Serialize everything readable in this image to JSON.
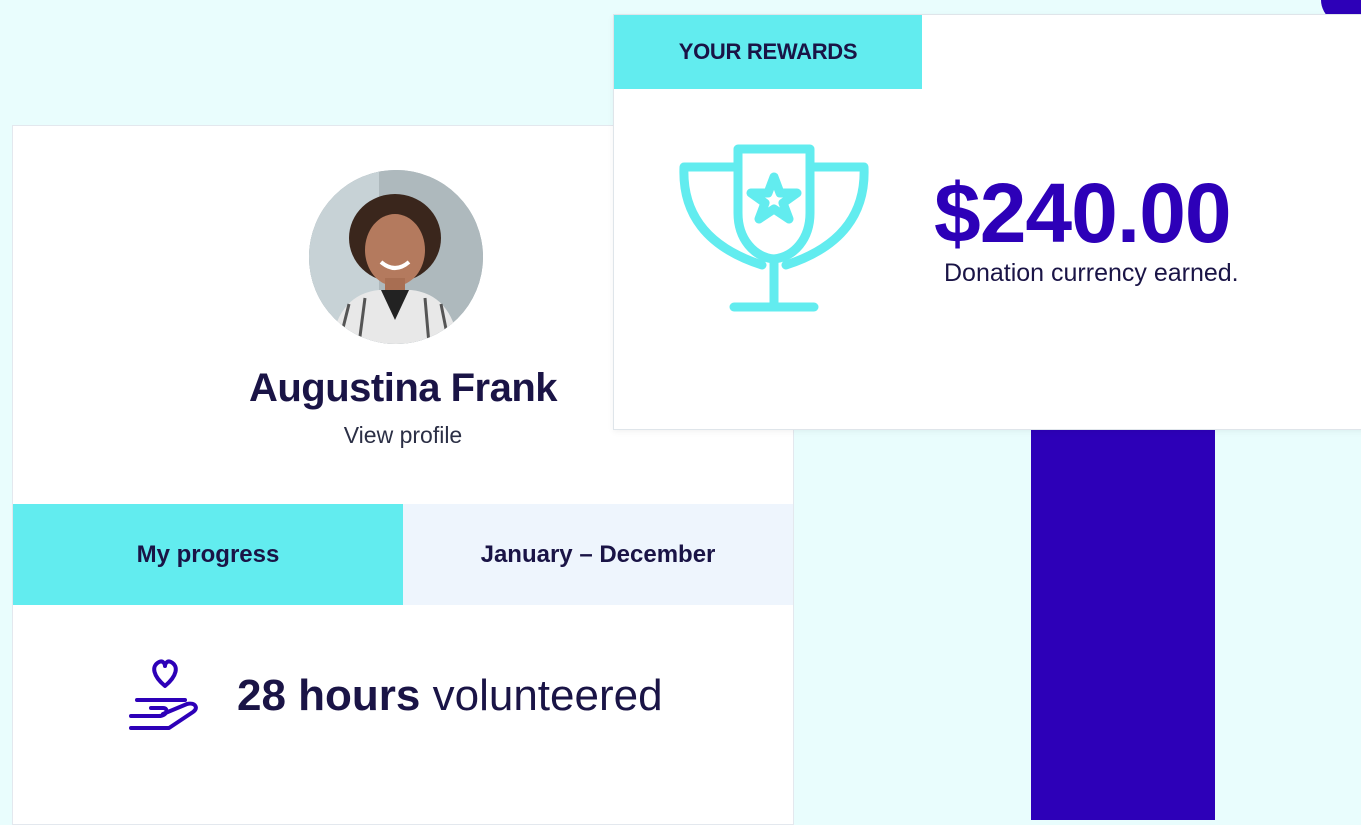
{
  "colors": {
    "accent_cyan": "#62ecef",
    "brand_navy": "#2d00b8",
    "text_dark": "#1a1446",
    "page_bg": "#e9fdfd"
  },
  "profile": {
    "name": "Augustina Frank",
    "view_profile_label": "View profile",
    "avatar_icon": "user-avatar-photo"
  },
  "tabs": [
    {
      "label": "My progress",
      "active": true
    },
    {
      "label": "January – December",
      "active": false
    }
  ],
  "progress": {
    "icon": "heart-hand-icon",
    "hours_value": "28 hours",
    "hours_suffix": " volunteered"
  },
  "rewards": {
    "tag_label": "YOUR REWARDS",
    "icon": "trophy-star-icon",
    "amount": "$240.00",
    "caption": "Donation currency earned."
  }
}
